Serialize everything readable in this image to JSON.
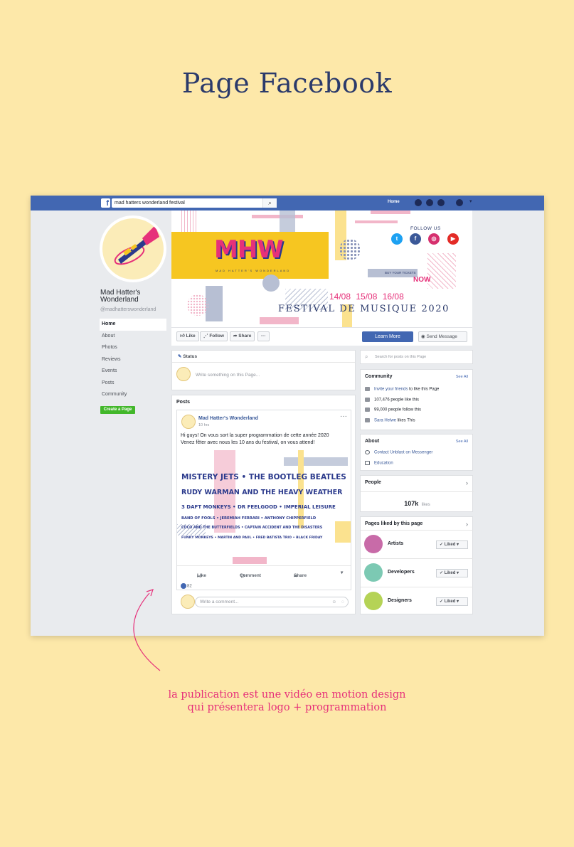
{
  "heading": "Page Facebook",
  "topbar": {
    "search_value": "mad hatters wonderland festival",
    "home_label": "Home"
  },
  "sidebar": {
    "page_name": "Mad Hatter's Wonderland",
    "handle": "@madhatterswonderland",
    "items": [
      {
        "label": "Home"
      },
      {
        "label": "About"
      },
      {
        "label": "Photos"
      },
      {
        "label": "Reviews"
      },
      {
        "label": "Events"
      },
      {
        "label": "Posts"
      },
      {
        "label": "Community"
      }
    ],
    "create_page": "Create a Page"
  },
  "cover": {
    "logo": "MHW",
    "logo_sub": "MAD HATTER'S WONDERLAND",
    "follow_us": "FOLLOW US",
    "buy_tickets": "BUY YOUR TICKETS",
    "now": "NOW",
    "dates": "14/08 15/08 16/08",
    "festival": "FESTIVAL DE MUSIQUE 2020"
  },
  "actions": {
    "like": "Like",
    "follow": "Follow",
    "share": "Share",
    "more": "···",
    "learn_more": "Learn More",
    "send_message": "Send Message"
  },
  "status": {
    "title": "Status",
    "placeholder": "Write something on this Page..."
  },
  "posts": {
    "title": "Posts",
    "author": "Mad Hatter's Wonderland",
    "time": "10 hrs",
    "text_line1": "Hi guys! On vous sort la super programmation de cette année 2020",
    "text_line2": "Venez fêter avec nous les 10 ans du festival, on vous attend!",
    "lineup": [
      "MISTERY JETS • THE BOOTLEG BEATLES",
      "RUDY WARMAN AND THE HEAVY WEATHER",
      "3 DAFT MONKEYS • DR FEELGOOD • IMPERIAL LEISURE",
      "BAND OF FOOLS • JEREMIAH FERRARI • ANTHONY CHIPPERFIELD",
      "COCO AND THE BUTTERFIELDS • CAPTAIN ACCIDENT AND THE DISASTERS",
      "FUNKY MONKEYS • MARTIN AND PAUL • FRED BATISTA TRIO • BLACK FRIDAY"
    ],
    "like": "Like",
    "comment": "Comment",
    "share": "Share",
    "reaction_count": "82",
    "comment_placeholder": "Write a comment..."
  },
  "right": {
    "search_placeholder": "Search for posts on this Page",
    "community": {
      "title": "Community",
      "see_all": "See All",
      "invite_link": "Invite your friends",
      "invite_rest": " to like this Page",
      "likes": "107,476 people like this",
      "follows": "99,000 people follow this",
      "friend_link": "Sara Helwe",
      "friend_rest": " likes This"
    },
    "about": {
      "title": "About",
      "see_all": "See All",
      "messenger": "Contact Unblast on Messenger",
      "category": "Education"
    },
    "people": {
      "title": "People",
      "count": "107k",
      "unit": "likes"
    },
    "liked_pages": {
      "title": "Pages liked by this page",
      "items": [
        {
          "name": "Artists",
          "button": "Liked",
          "color": "#c86ba8"
        },
        {
          "name": "Developers",
          "button": "Liked",
          "color": "#7cc9b3"
        },
        {
          "name": "Designers",
          "button": "Liked",
          "color": "#b5d356"
        }
      ]
    }
  },
  "annotation": {
    "line1": "la publication est une vidéo en motion design",
    "line2": "qui présentera logo + programmation"
  }
}
